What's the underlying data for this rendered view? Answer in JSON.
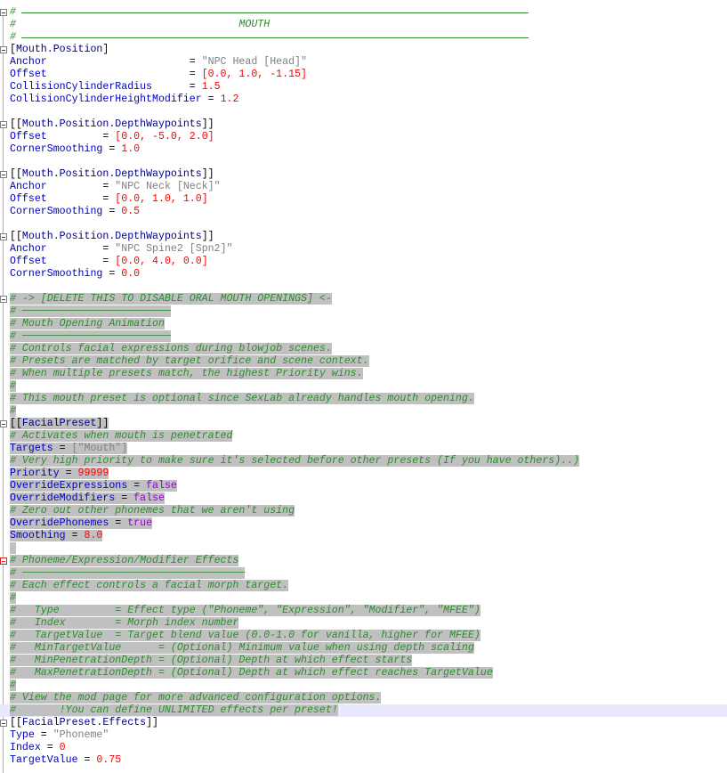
{
  "editor": {
    "lines": [
      {
        "id": "l1",
        "tokens": [
          {
            "t": "c",
            "v": "#"
          }
        ]
      },
      {
        "id": "l2",
        "tokens": [
          {
            "t": "c",
            "v": "#                                    MOUTH"
          }
        ]
      },
      {
        "id": "l3",
        "tokens": [
          {
            "t": "c",
            "v": "#"
          }
        ]
      },
      {
        "id": "l4",
        "tokens": [
          {
            "t": "br",
            "v": "["
          },
          {
            "t": "sec",
            "v": "Mouth.Position"
          },
          {
            "t": "br",
            "v": "]"
          }
        ]
      },
      {
        "id": "l5",
        "tokens": [
          {
            "t": "k",
            "v": "Anchor                       "
          },
          {
            "t": "o",
            "v": "= "
          },
          {
            "t": "s",
            "v": "\"NPC Head [Head]\""
          }
        ]
      },
      {
        "id": "l6",
        "tokens": [
          {
            "t": "k",
            "v": "Offset                       "
          },
          {
            "t": "o",
            "v": "= "
          },
          {
            "t": "n",
            "v": "[0.0, 1.0, -1.15]"
          }
        ]
      },
      {
        "id": "l7",
        "tokens": [
          {
            "t": "k",
            "v": "CollisionCylinderRadius      "
          },
          {
            "t": "o",
            "v": "= "
          },
          {
            "t": "n",
            "v": "1.5"
          }
        ]
      },
      {
        "id": "l8",
        "tokens": [
          {
            "t": "k",
            "v": "CollisionCylinderHeightModifier "
          },
          {
            "t": "o",
            "v": "= "
          },
          {
            "t": "n",
            "v": "1.2"
          }
        ]
      },
      {
        "id": "l9",
        "tokens": []
      },
      {
        "id": "l10",
        "tokens": [
          {
            "t": "br",
            "v": "[["
          },
          {
            "t": "sec",
            "v": "Mouth.Position.DepthWaypoints"
          },
          {
            "t": "br",
            "v": "]]"
          }
        ]
      },
      {
        "id": "l11",
        "tokens": [
          {
            "t": "k",
            "v": "Offset         "
          },
          {
            "t": "o",
            "v": "= "
          },
          {
            "t": "n",
            "v": "[0.0, -5.0, 2.0]"
          }
        ]
      },
      {
        "id": "l12",
        "tokens": [
          {
            "t": "k",
            "v": "CornerSmoothing "
          },
          {
            "t": "o",
            "v": "= "
          },
          {
            "t": "n",
            "v": "1.0"
          }
        ]
      },
      {
        "id": "l13",
        "tokens": []
      },
      {
        "id": "l14",
        "tokens": [
          {
            "t": "br",
            "v": "[["
          },
          {
            "t": "sec",
            "v": "Mouth.Position.DepthWaypoints"
          },
          {
            "t": "br",
            "v": "]]"
          }
        ]
      },
      {
        "id": "l15",
        "tokens": [
          {
            "t": "k",
            "v": "Anchor         "
          },
          {
            "t": "o",
            "v": "= "
          },
          {
            "t": "s",
            "v": "\"NPC Neck [Neck]\""
          }
        ]
      },
      {
        "id": "l16",
        "tokens": [
          {
            "t": "k",
            "v": "Offset         "
          },
          {
            "t": "o",
            "v": "= "
          },
          {
            "t": "n",
            "v": "[0.0, 1.0, 1.0]"
          }
        ]
      },
      {
        "id": "l17",
        "tokens": [
          {
            "t": "k",
            "v": "CornerSmoothing "
          },
          {
            "t": "o",
            "v": "= "
          },
          {
            "t": "n",
            "v": "0.5"
          }
        ]
      },
      {
        "id": "l18",
        "tokens": []
      },
      {
        "id": "l19",
        "tokens": [
          {
            "t": "br",
            "v": "[["
          },
          {
            "t": "sec",
            "v": "Mouth.Position.DepthWaypoints"
          },
          {
            "t": "br",
            "v": "]]"
          }
        ]
      },
      {
        "id": "l20",
        "tokens": [
          {
            "t": "k",
            "v": "Anchor         "
          },
          {
            "t": "o",
            "v": "= "
          },
          {
            "t": "s",
            "v": "\"NPC Spine2 [Spn2]\""
          }
        ]
      },
      {
        "id": "l21",
        "tokens": [
          {
            "t": "k",
            "v": "Offset         "
          },
          {
            "t": "o",
            "v": "= "
          },
          {
            "t": "n",
            "v": "[0.0, 4.0, 0.0]"
          }
        ]
      },
      {
        "id": "l22",
        "tokens": [
          {
            "t": "k",
            "v": "CornerSmoothing "
          },
          {
            "t": "o",
            "v": "= "
          },
          {
            "t": "n",
            "v": "0.0"
          }
        ]
      },
      {
        "id": "l23",
        "tokens": []
      },
      {
        "id": "l24",
        "hl": true,
        "tokens": [
          {
            "t": "c",
            "v": "# -> [DELETE THIS TO DISABLE ORAL MOUTH OPENINGS] <-"
          }
        ]
      },
      {
        "id": "l25",
        "hl": true,
        "tokens": [
          {
            "t": "c",
            "v": "# ────────────────────────"
          }
        ]
      },
      {
        "id": "l26",
        "hl": true,
        "tokens": [
          {
            "t": "c",
            "v": "# Mouth Opening Animation"
          }
        ]
      },
      {
        "id": "l27",
        "hl": true,
        "tokens": [
          {
            "t": "c",
            "v": "# ────────────────────────"
          }
        ]
      },
      {
        "id": "l28",
        "hl": true,
        "tokens": [
          {
            "t": "c",
            "v": "# Controls facial expressions during blowjob scenes."
          }
        ]
      },
      {
        "id": "l29",
        "hl": true,
        "tokens": [
          {
            "t": "c",
            "v": "# Presets are matched by target orifice and scene context."
          }
        ]
      },
      {
        "id": "l30",
        "hl": true,
        "tokens": [
          {
            "t": "c",
            "v": "# When multiple presets match, the highest Priority wins."
          }
        ]
      },
      {
        "id": "l31",
        "hl": true,
        "tokens": [
          {
            "t": "c",
            "v": "#"
          }
        ]
      },
      {
        "id": "l32",
        "hl": true,
        "tokens": [
          {
            "t": "c",
            "v": "# This mouth preset is optional since SexLab already handles mouth opening."
          }
        ]
      },
      {
        "id": "l33",
        "hl": true,
        "tokens": [
          {
            "t": "c",
            "v": "#"
          }
        ]
      },
      {
        "id": "l34",
        "hl": true,
        "tokens": [
          {
            "t": "br",
            "v": "[["
          },
          {
            "t": "sec",
            "v": "FacialPreset"
          },
          {
            "t": "br",
            "v": "]]"
          }
        ]
      },
      {
        "id": "l35",
        "hl": true,
        "tokens": [
          {
            "t": "c",
            "v": "# Activates when mouth is penetrated"
          }
        ]
      },
      {
        "id": "l36",
        "hl": true,
        "tokens": [
          {
            "t": "k",
            "v": "Targets "
          },
          {
            "t": "o",
            "v": "= "
          },
          {
            "t": "s",
            "v": "[\"Mouth\"]"
          }
        ]
      },
      {
        "id": "l37",
        "hl": true,
        "tokens": [
          {
            "t": "c",
            "v": "# Very high priority to make sure it's selected before other presets (If you have others)..)"
          }
        ]
      },
      {
        "id": "l38",
        "hl": true,
        "tokens": [
          {
            "t": "k",
            "v": "Priority "
          },
          {
            "t": "o",
            "v": "= "
          },
          {
            "t": "n",
            "v": "99999"
          }
        ]
      },
      {
        "id": "l39",
        "hl": true,
        "tokens": [
          {
            "t": "k",
            "v": "OverrideExpressions "
          },
          {
            "t": "o",
            "v": "= "
          },
          {
            "t": "b",
            "v": "false"
          }
        ]
      },
      {
        "id": "l40",
        "hl": true,
        "tokens": [
          {
            "t": "k",
            "v": "OverrideModifiers "
          },
          {
            "t": "o",
            "v": "= "
          },
          {
            "t": "b",
            "v": "false"
          }
        ]
      },
      {
        "id": "l41",
        "hl": true,
        "tokens": [
          {
            "t": "c",
            "v": "# Zero out other phonemes that we aren't using"
          }
        ]
      },
      {
        "id": "l42",
        "hl": true,
        "tokens": [
          {
            "t": "k",
            "v": "OverridePhonemes "
          },
          {
            "t": "o",
            "v": "= "
          },
          {
            "t": "b",
            "v": "true"
          }
        ]
      },
      {
        "id": "l43",
        "hl": true,
        "tokens": [
          {
            "t": "k",
            "v": "Smoothing "
          },
          {
            "t": "o",
            "v": "= "
          },
          {
            "t": "n",
            "v": "8.0"
          }
        ]
      },
      {
        "id": "l44",
        "hl": true,
        "tokens": [
          {
            "t": "o",
            "v": " "
          }
        ]
      },
      {
        "id": "l45",
        "hl": true,
        "tokens": [
          {
            "t": "c",
            "v": "# Phoneme/Expression/Modifier Effects"
          }
        ]
      },
      {
        "id": "l46",
        "hl": true,
        "tokens": [
          {
            "t": "c",
            "v": "# ────────────────────────────────────"
          }
        ]
      },
      {
        "id": "l47",
        "hl": true,
        "tokens": [
          {
            "t": "c",
            "v": "# Each effect controls a facial morph target."
          }
        ]
      },
      {
        "id": "l48",
        "hl": true,
        "tokens": [
          {
            "t": "c",
            "v": "#"
          }
        ]
      },
      {
        "id": "l49",
        "hl": true,
        "tokens": [
          {
            "t": "c",
            "v": "#   Type         = Effect type (\"Phoneme\", \"Expression\", \"Modifier\", \"MFEE\")"
          }
        ]
      },
      {
        "id": "l50",
        "hl": true,
        "tokens": [
          {
            "t": "c",
            "v": "#   Index        = Morph index number"
          }
        ]
      },
      {
        "id": "l51",
        "hl": true,
        "tokens": [
          {
            "t": "c",
            "v": "#   TargetValue  = Target blend value (0.0-1.0 for vanilla, higher for MFEE)"
          }
        ]
      },
      {
        "id": "l52",
        "hl": true,
        "tokens": [
          {
            "t": "c",
            "v": "#   MinTargetValue      = (Optional) Minimum value when using depth scaling"
          }
        ]
      },
      {
        "id": "l53",
        "hl": true,
        "tokens": [
          {
            "t": "c",
            "v": "#   MinPenetrationDepth = (Optional) Depth at which effect starts"
          }
        ]
      },
      {
        "id": "l54",
        "hl": true,
        "tokens": [
          {
            "t": "c",
            "v": "#   MaxPenetrationDepth = (Optional) Depth at which effect reaches TargetValue"
          }
        ]
      },
      {
        "id": "l55",
        "hl": true,
        "tokens": [
          {
            "t": "c",
            "v": "#"
          }
        ]
      },
      {
        "id": "l56",
        "hl": true,
        "tokens": [
          {
            "t": "c",
            "v": "# View the mod page for more advanced configuration options."
          }
        ]
      },
      {
        "id": "l57",
        "hl": true,
        "cur": true,
        "tokens": [
          {
            "t": "c",
            "v": "#       !You can define UNLIMITED effects per preset!"
          }
        ]
      },
      {
        "id": "l58",
        "tokens": [
          {
            "t": "br",
            "v": "[["
          },
          {
            "t": "sec",
            "v": "FacialPreset.Effects"
          },
          {
            "t": "br",
            "v": "]]"
          }
        ]
      },
      {
        "id": "l59",
        "tokens": [
          {
            "t": "k",
            "v": "Type "
          },
          {
            "t": "o",
            "v": "= "
          },
          {
            "t": "s",
            "v": "\"Phoneme\""
          }
        ]
      },
      {
        "id": "l60",
        "tokens": [
          {
            "t": "k",
            "v": "Index "
          },
          {
            "t": "o",
            "v": "= "
          },
          {
            "t": "n",
            "v": "0"
          }
        ]
      },
      {
        "id": "l61",
        "tokens": [
          {
            "t": "k",
            "v": "TargetValue "
          },
          {
            "t": "o",
            "v": "= "
          },
          {
            "t": "n",
            "v": "0.75"
          }
        ]
      }
    ]
  },
  "colors": {
    "comment": "#2e8b2e",
    "key": "#0000c0",
    "section": "#000080",
    "string": "#808080",
    "number": "#ff0000",
    "boolean": "#9400d3",
    "selection": "#c0c0c0",
    "current_line": "#e8e8ff"
  }
}
